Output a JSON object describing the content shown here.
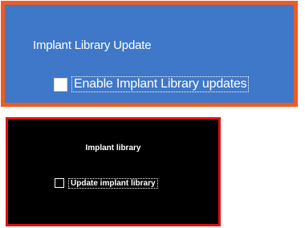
{
  "top_panel": {
    "title": "Implant Library Update",
    "checkbox_label": "Enable Implant Library updates",
    "checked": false,
    "background_color": "#3f78c8",
    "border_color": "#f05a24"
  },
  "bottom_panel": {
    "title": "Implant library",
    "checkbox_label": "Update implant library",
    "checked": false,
    "background_color": "#000000",
    "border_color": "#e01010"
  }
}
